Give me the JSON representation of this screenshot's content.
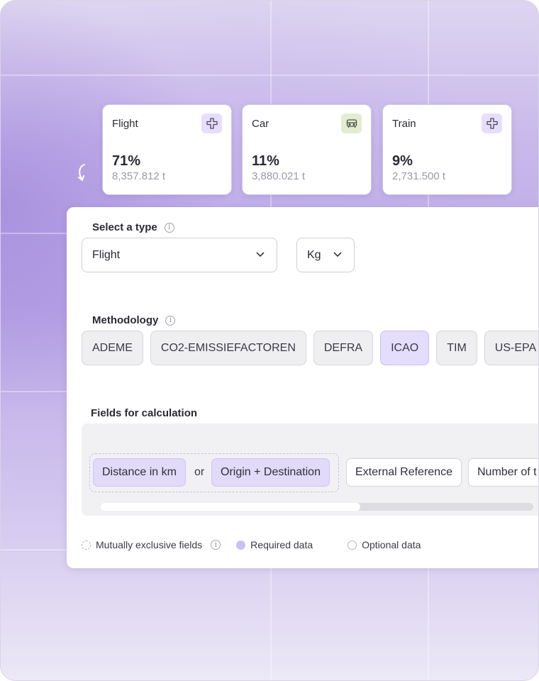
{
  "stats": [
    {
      "name": "Flight",
      "percent": "71%",
      "tonnes": "8,357.812 t",
      "icon": "plane-icon",
      "icon_color": "#e6defa"
    },
    {
      "name": "Car",
      "percent": "11%",
      "tonnes": "3,880.021 t",
      "icon": "car-icon",
      "icon_color": "#e3ecd2"
    },
    {
      "name": "Train",
      "percent": "9%",
      "tonnes": "2,731.500 t",
      "icon": "plane-icon",
      "icon_color": "#e6defa"
    }
  ],
  "type_section": {
    "label": "Select a type",
    "type_value": "Flight",
    "unit_value": "Kg"
  },
  "methodology": {
    "label": "Methodology",
    "options": [
      "ADEME",
      "CO2-EMISSIEFACTOREN",
      "DEFRA",
      "ICAO",
      "TIM",
      "US-EPA"
    ],
    "selected": "ICAO"
  },
  "fields": {
    "label": "Fields for calculation",
    "distance": "Distance in km",
    "or_text": "or",
    "origin_destination": "Origin + Destination",
    "external_reference": "External Reference",
    "number_of": "Number of t",
    "scroll_fraction": 0.6
  },
  "legend": {
    "mutually_exclusive": "Mutually exclusive fields",
    "required": "Required data",
    "optional": "Optional data"
  },
  "colors": {
    "accent": "#e5defb",
    "required": "#cbc0f4"
  }
}
